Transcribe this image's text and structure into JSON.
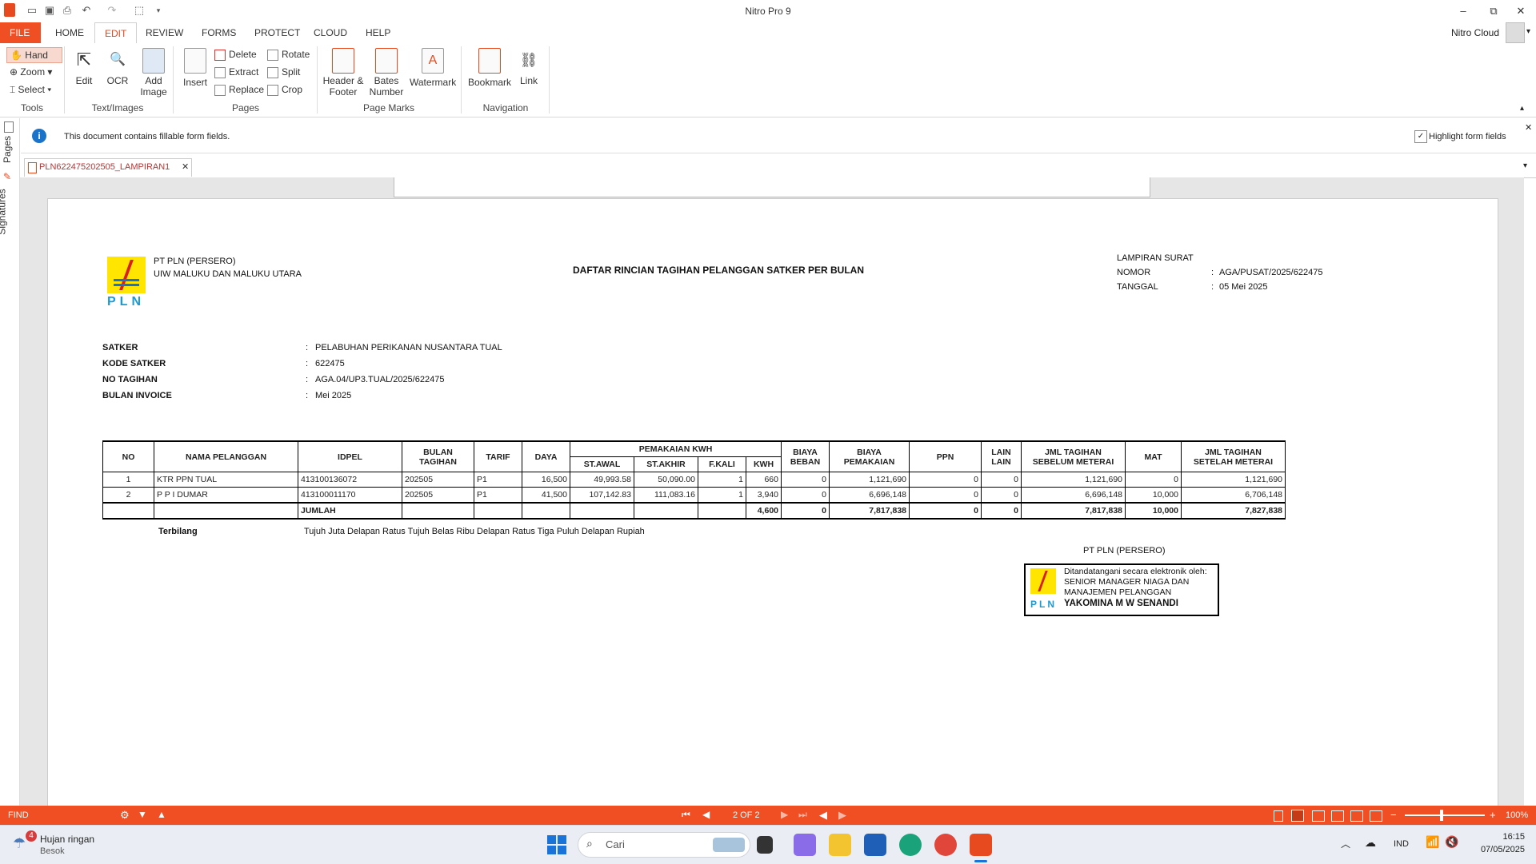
{
  "window": {
    "title": "Nitro Pro 9",
    "min": "–",
    "max": "⧉",
    "close": "✕"
  },
  "tabs": [
    "FILE",
    "HOME",
    "EDIT",
    "REVIEW",
    "FORMS",
    "PROTECT",
    "CLOUD",
    "HELP"
  ],
  "active_tab": "EDIT",
  "account": {
    "label": "Nitro Cloud"
  },
  "ribbon": {
    "tools": {
      "hand": "Hand",
      "zoom": "Zoom",
      "select": "Select",
      "group": "Tools"
    },
    "text_images": {
      "edit": "Edit",
      "ocr": "OCR",
      "add_image_1": "Add",
      "add_image_2": "Image",
      "group": "Text/Images"
    },
    "pages": {
      "insert": "Insert",
      "delete": "Delete",
      "extract": "Extract",
      "replace": "Replace",
      "rotate": "Rotate",
      "split": "Split",
      "crop": "Crop",
      "group": "Pages"
    },
    "page_marks": {
      "header_1": "Header &",
      "header_2": "Footer",
      "bates_1": "Bates",
      "bates_2": "Number",
      "watermark": "Watermark",
      "group": "Page Marks"
    },
    "navigation": {
      "bookmark": "Bookmark",
      "link": "Link",
      "group": "Navigation"
    }
  },
  "infobar": {
    "message": "This document contains fillable form fields.",
    "highlight_label": "Highlight form fields"
  },
  "siderail": {
    "pages": "Pages",
    "signatures": "Signatures"
  },
  "doc_tab": {
    "name": "PLN622475202505_LAMPIRAN1"
  },
  "document": {
    "company_1": "PT PLN (PERSERO)",
    "company_2": "UIW MALUKU DAN MALUKU UTARA",
    "logo_text": "PLN",
    "heading": "DAFTAR RINCIAN TAGIHAN PELANGGAN SATKER PER BULAN",
    "lampiran": "LAMPIRAN SURAT",
    "nomor_label": "NOMOR",
    "nomor_value": "AGA/PUSAT/2025/622475",
    "tanggal_label": "TANGGAL",
    "tanggal_value": "05 Mei 2025",
    "colon": ":",
    "fields": [
      {
        "label": "SATKER",
        "value": "PELABUHAN PERIKANAN NUSANTARA TUAL"
      },
      {
        "label": "KODE SATKER",
        "value": "622475"
      },
      {
        "label": "NO TAGIHAN",
        "value": "AGA.04/UP3.TUAL/2025/622475"
      },
      {
        "label": "BULAN INVOICE",
        "value": "Mei 2025"
      }
    ],
    "table": {
      "headers": {
        "no": "NO",
        "nama": "NAMA PELANGGAN",
        "idpel": "IDPEL",
        "bulan_1": "BULAN",
        "bulan_2": "TAGIHAN",
        "tarif": "TARIF",
        "daya": "DAYA",
        "pemakaian": "PEMAKAIAN KWH",
        "st_awal": "ST.AWAL",
        "st_akhir": "ST.AKHIR",
        "fkali": "F.KALI",
        "kwh": "KWH",
        "biaya_beban_1": "BIAYA",
        "biaya_beban_2": "BEBAN",
        "biaya_pemakaian_1": "BIAYA",
        "biaya_pemakaian_2": "PEMAKAIAN",
        "ppn": "PPN",
        "lain_1": "LAIN",
        "lain_2": "LAIN",
        "jml_sebelum_1": "JML TAGIHAN",
        "jml_sebelum_2": "SEBELUM METERAI",
        "mat": "MAT",
        "jml_setelah_1": "JML TAGIHAN",
        "jml_setelah_2": "SETELAH METERAI"
      },
      "rows": [
        {
          "no": "1",
          "nama": "KTR PPN TUAL",
          "idpel": "413100136072",
          "bulan": "202505",
          "tarif": "P1",
          "daya": "16,500",
          "st_awal": "49,993.58",
          "st_akhir": "50,090.00",
          "fkali": "1",
          "kwh": "660",
          "biaya_beban": "0",
          "biaya_pemakaian": "1,121,690",
          "ppn": "0",
          "lain": "0",
          "jml_sebelum": "1,121,690",
          "mat": "0",
          "jml_setelah": "1,121,690"
        },
        {
          "no": "2",
          "nama": "P P I DUMAR",
          "idpel": "413100011170",
          "bulan": "202505",
          "tarif": "P1",
          "daya": "41,500",
          "st_awal": "107,142.83",
          "st_akhir": "111,083.16",
          "fkali": "1",
          "kwh": "3,940",
          "biaya_beban": "0",
          "biaya_pemakaian": "6,696,148",
          "ppn": "0",
          "lain": "0",
          "jml_sebelum": "6,696,148",
          "mat": "10,000",
          "jml_setelah": "6,706,148"
        }
      ],
      "total": {
        "label": "JUMLAH",
        "kwh": "4,600",
        "biaya_beban": "0",
        "biaya_pemakaian": "7,817,838",
        "ppn": "0",
        "lain": "0",
        "jml_sebelum": "7,817,838",
        "mat": "10,000",
        "jml_setelah": "7,827,838"
      }
    },
    "terbilang_label": "Terbilang",
    "terbilang_value": "Tujuh Juta Delapan Ratus Tujuh Belas Ribu Delapan Ratus Tiga Puluh Delapan  Rupiah",
    "sign_company": "PT PLN (PERSERO)",
    "sign_line1": "Ditandatangani secara elektronik oleh:",
    "sign_line2": "SENIOR MANAGER NIAGA DAN",
    "sign_line3": "MANAJEMEN PELANGGAN",
    "sign_name": "YAKOMINA M W SENANDI"
  },
  "statusbar": {
    "find": "FIND",
    "page": "2 OF 2",
    "zoom": "100%",
    "minus": "−",
    "plus": "+"
  },
  "taskbar": {
    "weather_title": "Hujan ringan",
    "weather_sub": "Besok",
    "weather_badge": "4",
    "search_placeholder": "Cari",
    "lang": "IND",
    "time": "16:15",
    "date": "07/05/2025"
  }
}
